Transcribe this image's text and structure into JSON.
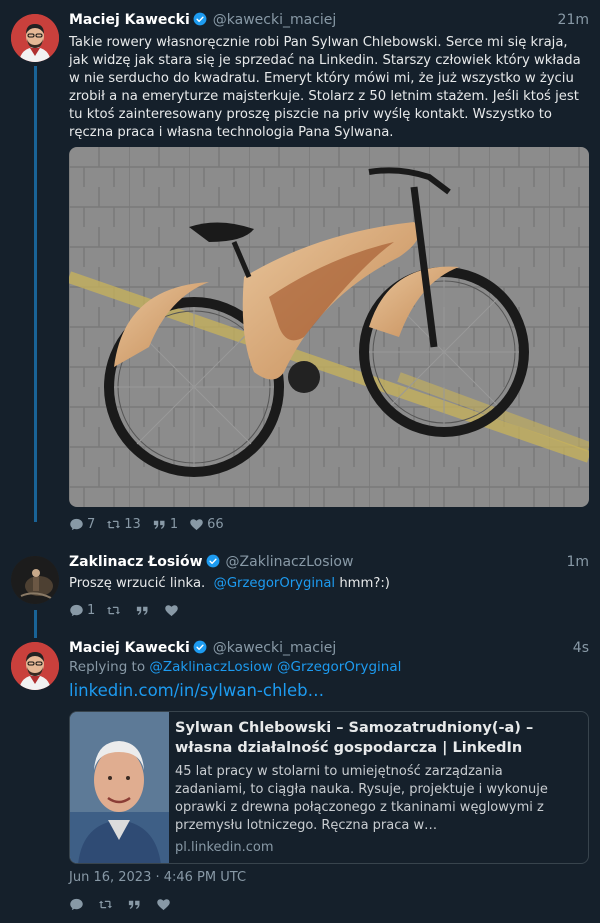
{
  "tweets": [
    {
      "author": "Maciej Kawecki",
      "handle": "@kawecki_maciej",
      "time": "21m",
      "text": "Takie rowery własnoręcznie robi Pan Sylwan Chlebowski. Serce mi się kraja, jak widzę jak stara się je sprzedać na Linkedin. Starszy człowiek który wkłada w nie serducho do kwadratu. Emeryt który mówi mi, że już wszystko w życiu zrobił a na emeryturze majsterkuje. Stolarz z 50 letnim stażem. Jeśli ktoś jest tu ktoś zainteresowany proszę piszcie na priv wyślę kontakt. Wszystko to ręczna praca i własna technologia Pana Sylwana.",
      "actions": {
        "replies": "7",
        "retweets": "13",
        "quotes": "1",
        "likes": "66"
      }
    },
    {
      "author": "Zaklinacz Łosiów",
      "handle": "@ZaklinaczLosiow",
      "time": "1m",
      "text_before": "Proszę wrzucić linka.",
      "mention": "@GrzegorOryginal",
      "text_after": "hmm?:)",
      "actions": {
        "replies": "1",
        "retweets": "",
        "quotes": "",
        "likes": ""
      }
    },
    {
      "author": "Maciej Kawecki",
      "handle": "@kawecki_maciej",
      "time": "4s",
      "replying_label": "Replying to",
      "replying_to": "@ZaklinaczLosiow @GrzegorOryginal",
      "link": "linkedin.com/in/sylwan-chleb…",
      "card": {
        "title": "Sylwan Chlebowski – Samozatrudniony(-a) – własna działalność gospodarcza | LinkedIn",
        "description": "45 lat pracy w stolarni to umiejętność zarządzania zadaniami, to ciągła nauka. Rysuje, projektuje i wykonuje oprawki z drewna połączonego z tkaninami węglowymi z przemysłu lotniczego. Ręczna praca w…",
        "domain": "pl.linkedin.com"
      },
      "date": "Jun 16, 2023 · 4:46 PM UTC"
    }
  ],
  "colors": {
    "background": "#15202b",
    "accent": "#1d9bf0",
    "muted": "#8899a6"
  },
  "icons": [
    "reply-icon",
    "retweet-icon",
    "quote-icon",
    "like-icon",
    "verified-icon"
  ]
}
